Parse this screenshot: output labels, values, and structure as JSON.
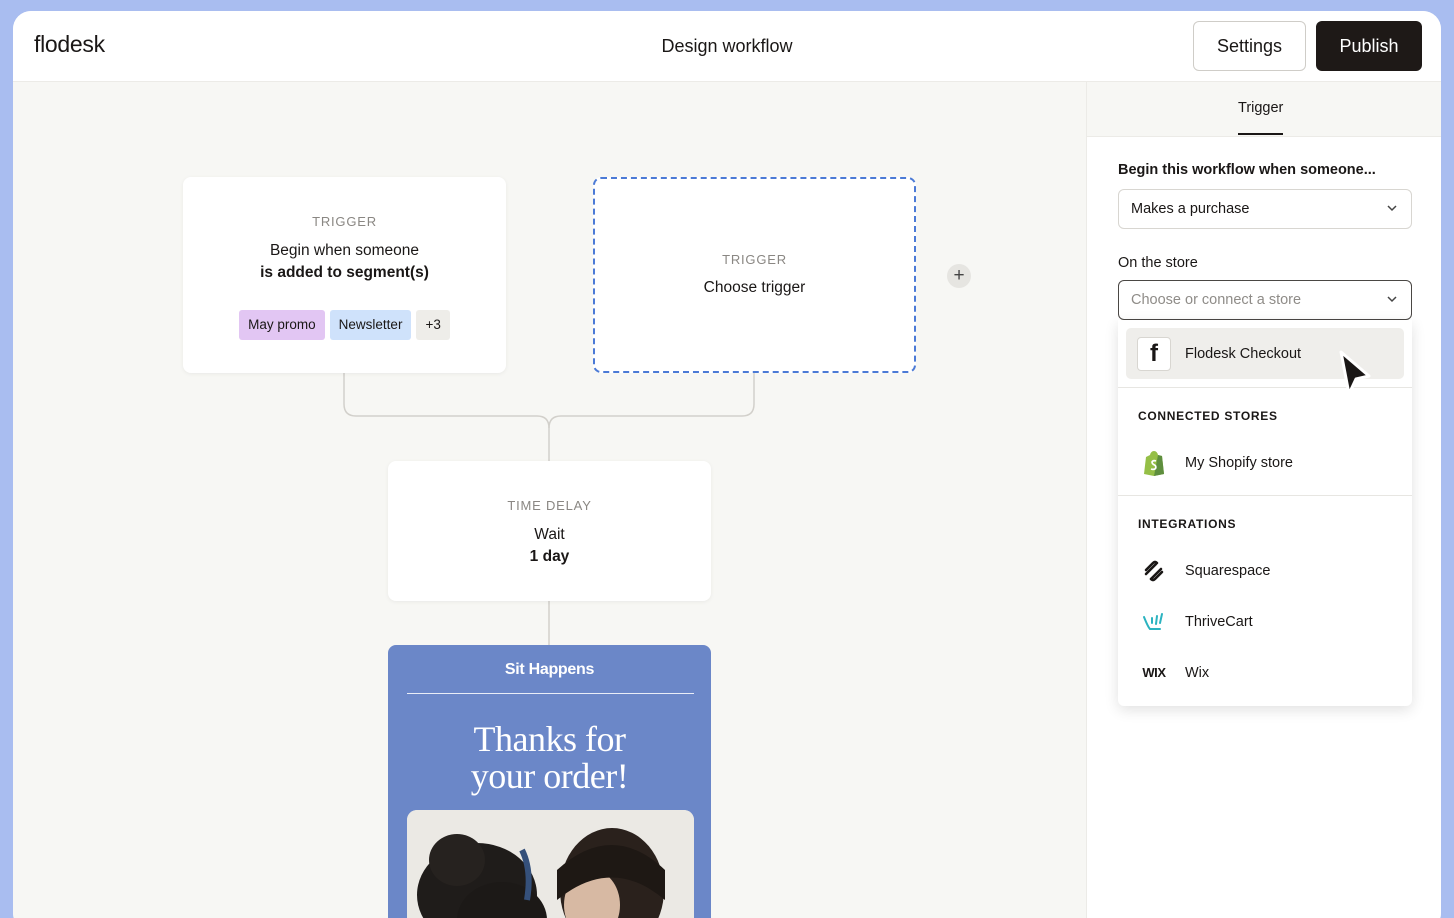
{
  "app": {
    "logo": "flodesk",
    "page_title": "Design workflow"
  },
  "toolbar": {
    "settings_label": "Settings",
    "publish_label": "Publish"
  },
  "canvas": {
    "trigger_card": {
      "kind": "TRIGGER",
      "line1": "Begin when someone",
      "line2": "is added to segment(s)",
      "tags": [
        "May promo",
        "Newsletter",
        "+3"
      ]
    },
    "choose_card": {
      "kind": "TRIGGER",
      "line1": "Choose trigger"
    },
    "add_symbol": "+",
    "delay_card": {
      "kind": "TIME DELAY",
      "line1": "Wait",
      "line2": "1 day"
    },
    "email_card": {
      "brand": "Sit Happens",
      "headline_line1": "Thanks for",
      "headline_line2": "your order!"
    }
  },
  "panel": {
    "tab": "Trigger",
    "begin_label": "Begin this workflow when someone...",
    "begin_value": "Makes a purchase",
    "store_label": "On the store",
    "store_placeholder": "Choose or connect a store",
    "dropdown": {
      "default_item": {
        "label": "Flodesk Checkout",
        "icon": "flodesk-f-icon"
      },
      "connected_heading": "CONNECTED STORES",
      "connected": [
        {
          "label": "My Shopify store",
          "icon": "shopify-icon"
        }
      ],
      "integrations_heading": "INTEGRATIONS",
      "integrations": [
        {
          "label": "Squarespace",
          "icon": "squarespace-icon"
        },
        {
          "label": "ThriveCart",
          "icon": "thrivecart-icon"
        },
        {
          "label": "Wix",
          "icon": "wix-icon",
          "icon_text": "WIX"
        }
      ]
    }
  },
  "colors": {
    "background": "#a9bdf0",
    "publish": "#1e1917",
    "dashed_border": "#4b7ad6",
    "email_card": "#6b87c8",
    "tag_purple": "#e2c6f3",
    "tag_blue": "#cfe2fb",
    "shopify": "#95bf47",
    "thrivecart": "#2bb3c0"
  }
}
